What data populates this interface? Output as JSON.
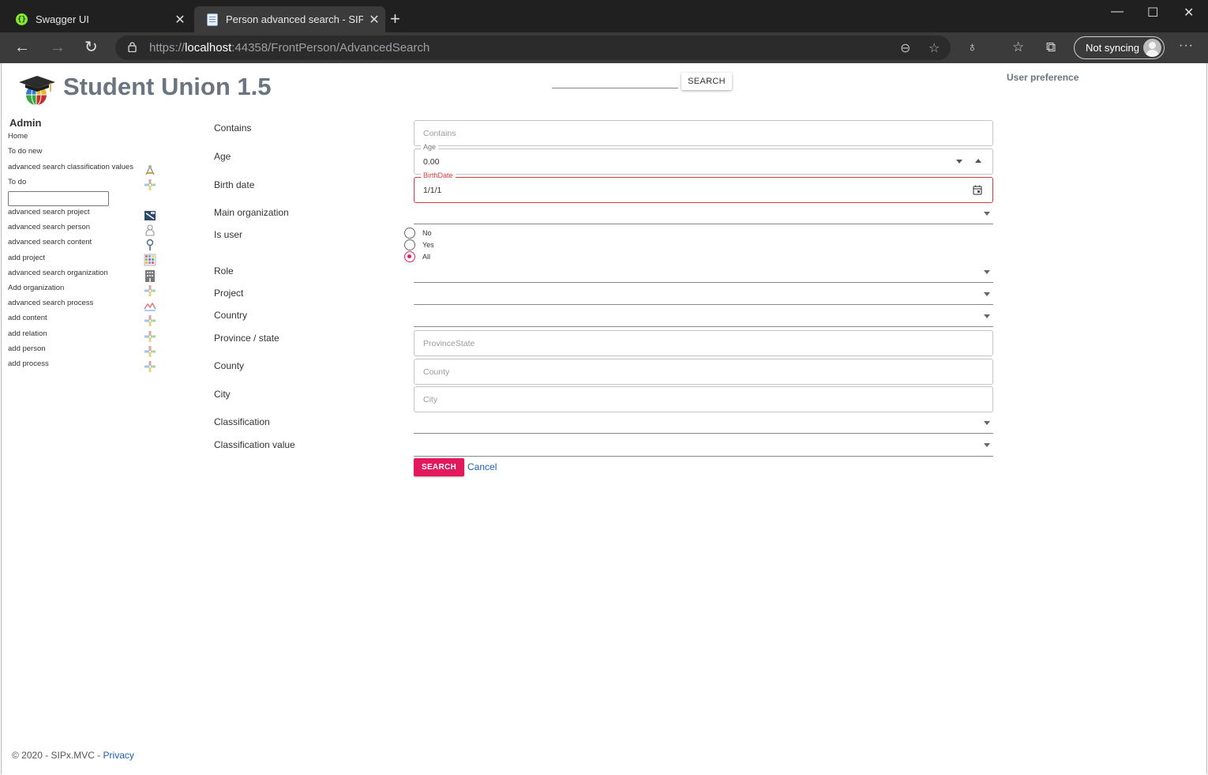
{
  "browser": {
    "tabs": [
      {
        "title": "Swagger UI",
        "favicon": "swagger-icon",
        "active": false
      },
      {
        "title": "Person advanced search - SIPx.M",
        "favicon": "page-icon",
        "active": true
      }
    ],
    "url_scheme": "https://",
    "url_host": "localhost",
    "url_rest": ":44358/FrontPerson/AdvancedSearch",
    "profile_label": "Not syncing"
  },
  "header": {
    "brand": "Student Union 1.5",
    "search_button": "SEARCH",
    "user_preference": "User preference"
  },
  "sidebar": {
    "title": "Admin",
    "items": [
      {
        "label": "Home",
        "icon": ""
      },
      {
        "label": "To do new",
        "icon": ""
      },
      {
        "label": "advanced search classification values",
        "icon": "classification-icon"
      },
      {
        "label": "To do",
        "icon": "plus-icon"
      },
      {
        "label": "advanced search project",
        "icon": "project-icon"
      },
      {
        "label": "advanced search person",
        "icon": "person-icon"
      },
      {
        "label": "advanced search content",
        "icon": "magnifier-icon"
      },
      {
        "label": "add project",
        "icon": "grid-icon"
      },
      {
        "label": "advanced search organization",
        "icon": "building-icon"
      },
      {
        "label": "Add organization",
        "icon": "plus-icon"
      },
      {
        "label": "advanced search process",
        "icon": "process-icon"
      },
      {
        "label": "add content",
        "icon": "plus-icon"
      },
      {
        "label": "add relation",
        "icon": "plus-icon"
      },
      {
        "label": "add person",
        "icon": "plus-icon"
      },
      {
        "label": "add process",
        "icon": "plus-icon"
      }
    ]
  },
  "form": {
    "contains": {
      "label": "Contains",
      "placeholder": "Contains"
    },
    "age": {
      "label": "Age",
      "float_label": "Age",
      "value": "0.00"
    },
    "birth_date": {
      "label": "Birth date",
      "float_label": "BirthDate",
      "value": "1/1/1"
    },
    "main_organization": {
      "label": "Main organization"
    },
    "is_user": {
      "label": "Is user",
      "options": [
        "No",
        "Yes",
        "All"
      ],
      "selected": "All"
    },
    "role": {
      "label": "Role"
    },
    "project": {
      "label": "Project"
    },
    "country": {
      "label": "Country"
    },
    "province_state": {
      "label": "Province / state",
      "placeholder": "ProvinceState"
    },
    "county": {
      "label": "County",
      "placeholder": "County"
    },
    "city": {
      "label": "City",
      "placeholder": "City"
    },
    "classification": {
      "label": "Classification"
    },
    "classification_value": {
      "label": "Classification value"
    },
    "submit_label": "SEARCH",
    "cancel_label": "Cancel"
  },
  "footer": {
    "copyright": "© 2020 - SIPx.MVC - ",
    "privacy": "Privacy"
  },
  "colors": {
    "accent": "#e2195c",
    "error": "#d23c3c",
    "brand_text": "#6b7580",
    "link": "#1a5fb4"
  }
}
